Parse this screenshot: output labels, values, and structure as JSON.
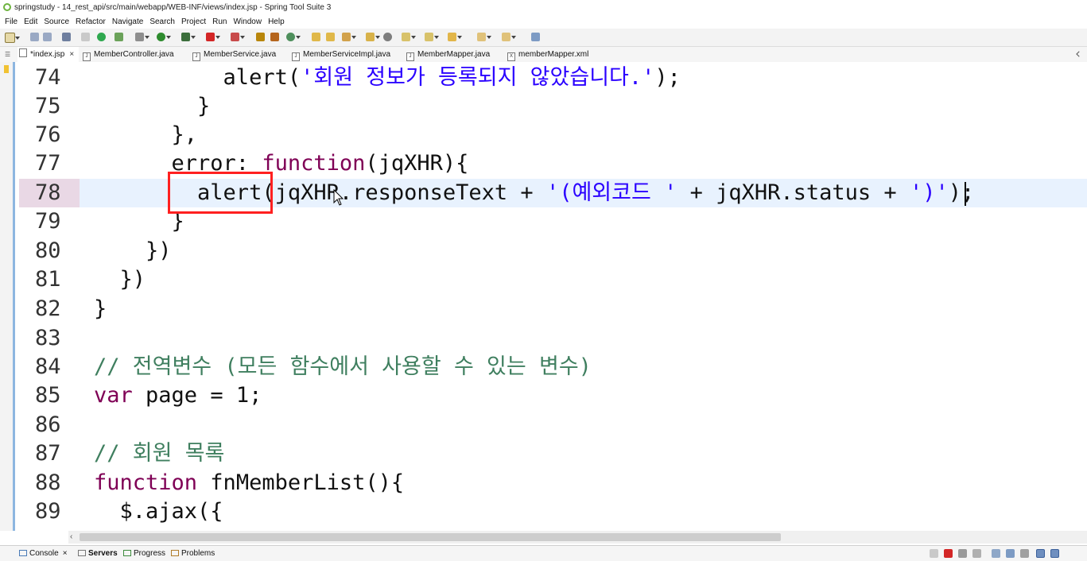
{
  "window": {
    "title": "springstudy - 14_rest_api/src/main/webapp/WEB-INF/views/index.jsp - Spring Tool Suite 3"
  },
  "menu": [
    "File",
    "Edit",
    "Source",
    "Refactor",
    "Navigate",
    "Search",
    "Project",
    "Run",
    "Window",
    "Help"
  ],
  "tabs": [
    {
      "label": "*index.jsp",
      "icon": "jsp-file-icon",
      "active": true,
      "closable": true
    },
    {
      "label": "MemberController.java",
      "icon": "java-file-icon"
    },
    {
      "label": "MemberService.java",
      "icon": "java-file-icon"
    },
    {
      "label": "MemberServiceImpl.java",
      "icon": "java-file-icon"
    },
    {
      "label": "MemberMapper.java",
      "icon": "java-file-icon"
    },
    {
      "label": "memberMapper.xml",
      "icon": "xml-file-icon"
    }
  ],
  "editor": {
    "current_line": 78,
    "lines": [
      {
        "num": "74",
        "code": "          alert('회원 정보가 등록되지 않았습니다.');"
      },
      {
        "num": "75",
        "code": "        }"
      },
      {
        "num": "76",
        "code": "      },"
      },
      {
        "num": "77",
        "code": "      error: function(jqXHR){"
      },
      {
        "num": "78",
        "code": "        alert(jqXHR.responseText + '(예외코드 ' + jqXHR.status + ')');"
      },
      {
        "num": "79",
        "code": "      }"
      },
      {
        "num": "80",
        "code": "    })"
      },
      {
        "num": "81",
        "code": "  })"
      },
      {
        "num": "82",
        "code": "}"
      },
      {
        "num": "83",
        "code": ""
      },
      {
        "num": "84",
        "code": "// 전역변수 (모든 함수에서 사용할 수 있는 변수)"
      },
      {
        "num": "85",
        "code": "var page = 1;"
      },
      {
        "num": "86",
        "code": ""
      },
      {
        "num": "87",
        "code": "// 회원 목록"
      },
      {
        "num": "88",
        "code": "function fnMemberList(){"
      },
      {
        "num": "89",
        "code": "  $.ajax({"
      }
    ]
  },
  "bottom_tabs": [
    {
      "label": "Console",
      "closable": true,
      "icon": "console-icon"
    },
    {
      "label": "Servers",
      "bold": true,
      "icon": "servers-icon"
    },
    {
      "label": "Progress",
      "icon": "progress-icon"
    },
    {
      "label": "Problems",
      "icon": "problems-icon"
    }
  ],
  "colors": {
    "keyword": "#7f0055",
    "string": "#2a00ff",
    "comment": "#3f7f5f",
    "highlight_box": "#ff2020",
    "current_line": "#e8f2fe"
  }
}
